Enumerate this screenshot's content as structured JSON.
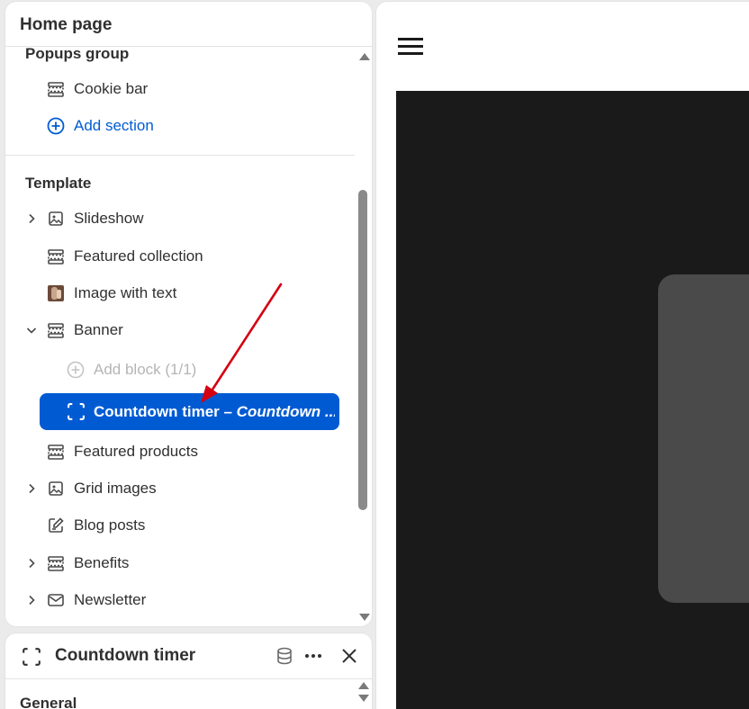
{
  "panel": {
    "title": "Home page",
    "groups": {
      "popups": {
        "title": "Popups group",
        "items": [
          {
            "label": "Cookie bar",
            "icon": "section-icon"
          },
          {
            "label": "Add section",
            "icon": "plus-circle-icon"
          }
        ]
      },
      "template": {
        "title": "Template",
        "items": [
          {
            "label": "Slideshow",
            "icon": "slideshow-icon",
            "expandable": true
          },
          {
            "label": "Featured collection",
            "icon": "section-icon"
          },
          {
            "label": "Image with text",
            "icon": "image-thumbnail"
          },
          {
            "label": "Banner",
            "icon": "section-icon",
            "expanded": true
          },
          {
            "label": "Add block (1/1)",
            "icon": "plus-circle-icon",
            "disabled": true
          },
          {
            "label": "Featured products",
            "icon": "section-icon"
          },
          {
            "label": "Grid images",
            "icon": "image-icon",
            "expandable": true
          },
          {
            "label": "Blog posts",
            "icon": "edit-icon"
          },
          {
            "label": "Benefits",
            "icon": "section-icon",
            "expandable": true
          },
          {
            "label": "Newsletter",
            "icon": "envelope-icon",
            "expandable": true
          }
        ],
        "selected": {
          "label": "Countdown timer",
          "sub": " – Countdown ..."
        }
      }
    }
  },
  "settings": {
    "title": "Countdown timer",
    "section": "General"
  },
  "colors": {
    "accent": "#005bd3",
    "preview_dark": "#1a1a1a",
    "preview_card": "#4a4a4a",
    "annotation_arrow": "#d40012"
  }
}
